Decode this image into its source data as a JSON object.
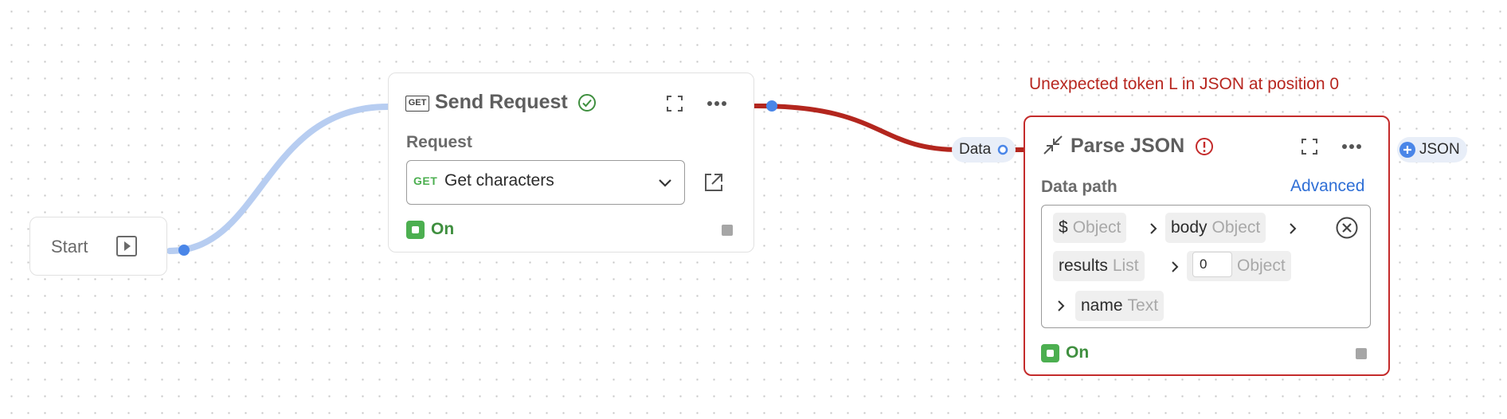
{
  "start_node": {
    "label": "Start",
    "icon": "play-icon"
  },
  "send_request": {
    "badge": "GET",
    "title": "Send Request",
    "status_icon": "check-circle-icon",
    "request_label": "Request",
    "method_tag": "GET",
    "request_value": "Get characters",
    "toggle_label": "On",
    "toggle_on": true
  },
  "error_message": "Unexpected token L in JSON at position 0",
  "connection_port": {
    "label": "Data"
  },
  "parse_json": {
    "title": "Parse JSON",
    "status_icon": "error-circle-icon",
    "data_path_label": "Data path",
    "advanced_label": "Advanced",
    "path": [
      {
        "name": "$",
        "type": "Object"
      },
      {
        "name": "body",
        "type": "Object"
      },
      {
        "name": "results",
        "type": "List"
      },
      {
        "index": "0",
        "type": "Object"
      },
      {
        "name": "name",
        "type": "Text"
      }
    ],
    "toggle_label": "On",
    "toggle_on": true
  },
  "output_port": {
    "label": "JSON"
  },
  "colors": {
    "wire_ok": "#b7cdf1",
    "wire_error": "#b3261e",
    "port_blue": "#4a86e8",
    "error_red": "#c42b2b",
    "on_green": "#4caf50",
    "link_blue": "#2f6fd6"
  }
}
